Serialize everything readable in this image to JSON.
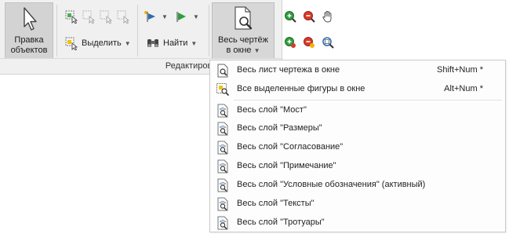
{
  "ribbon": {
    "edit_objects": {
      "line1": "Правка",
      "line2": "объектов",
      "icon": "cursor-icon"
    },
    "select_label": "Выделить",
    "find_label": "Найти",
    "zoom_all": {
      "line1": "Весь чертёж",
      "line2": "в окне",
      "icon": "page-zoom-icon"
    },
    "group_caption": "Редактирование и по"
  },
  "menu": {
    "items": [
      {
        "label": "Весь лист чертежа в окне",
        "shortcut": "Shift+Num *",
        "icon": "sheet-zoom-icon"
      },
      {
        "label": "Все выделенные фигуры в окне",
        "shortcut": "Alt+Num *",
        "icon": "selection-zoom-icon"
      },
      {
        "label": "Весь слой \"Мост\"",
        "icon": "layer-zoom-icon"
      },
      {
        "label": "Весь слой \"Размеры\"",
        "icon": "layer-zoom-icon"
      },
      {
        "label": "Весь слой \"Согласование\"",
        "icon": "layer-zoom-icon"
      },
      {
        "label": "Весь слой \"Примечание\"",
        "icon": "layer-zoom-icon"
      },
      {
        "label": "Весь слой \"Условные обозначения\" (активный)",
        "icon": "layer-zoom-icon"
      },
      {
        "label": "Весь слой \"Тексты\"",
        "icon": "layer-zoom-icon"
      },
      {
        "label": "Весь слой \"Тротуары\"",
        "icon": "layer-zoom-icon"
      }
    ]
  },
  "colors": {
    "accent_green": "#2e9e3c",
    "accent_red": "#d73a2b",
    "zoom_blue": "#2b6cb0"
  }
}
